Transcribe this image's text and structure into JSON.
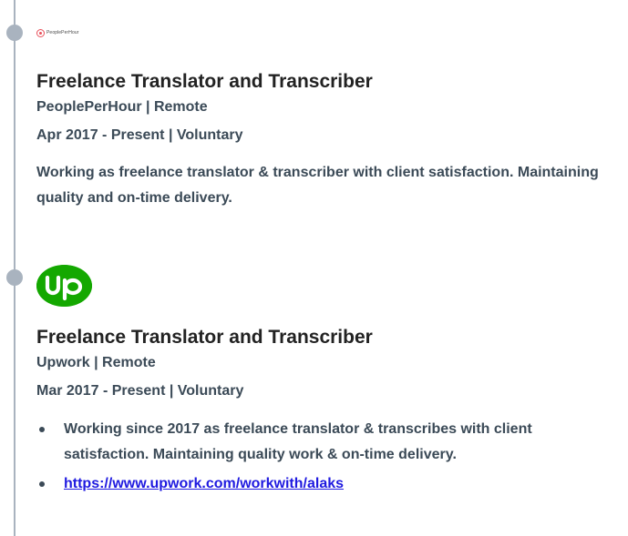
{
  "timeline": {
    "entries": [
      {
        "logo": {
          "icon": "peopleperhour-logo-icon",
          "text": "PeoplePerHour",
          "color": "#e8505b"
        },
        "title": "Freelance Translator and Transcriber",
        "company": "PeoplePerHour | Remote",
        "dates": "Apr 2017 - Present | Voluntary",
        "description": "Working as freelance translator & transcriber with client satisfaction. Maintaining quality and on-time delivery."
      },
      {
        "logo": {
          "icon": "upwork-logo-icon",
          "text": "up",
          "color": "#14a800"
        },
        "title": "Freelance Translator and Transcriber",
        "company": "Upwork | Remote",
        "dates": "Mar 2017 - Present | Voluntary",
        "bullets": [
          "Working since 2017 as freelance translator & transcribes with client satisfaction. Maintaining quality work & on-time delivery.",
          "https://www.upwork.com/workwith/alaks"
        ]
      }
    ]
  },
  "colors": {
    "timeline": "#a9b3bf",
    "link": "#1f1ae0",
    "text": "#3b4a57"
  }
}
